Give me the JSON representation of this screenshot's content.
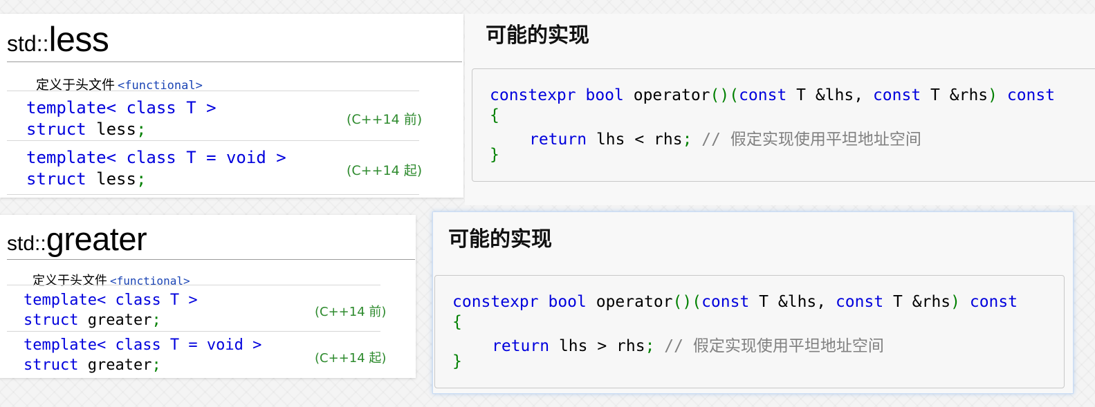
{
  "less": {
    "title_ns": "std::",
    "title_name": "less",
    "header_label": "定义于头文件",
    "header_file": "<functional>",
    "decls": [
      {
        "line1_kw": "template",
        "line1_rest": "< class T >",
        "line2_kw": "struct",
        "line2_name": " less",
        "line2_semi": ";",
        "version": "(C++14 前)"
      },
      {
        "line1_kw": "template",
        "line1_rest": "< class T = void >",
        "line2_kw": "struct",
        "line2_name": " less",
        "line2_semi": ";",
        "version": "(C++14 起)"
      }
    ],
    "impl": {
      "title": "可能的实现",
      "sig": {
        "kw1": "constexpr",
        "kw2": "bool",
        "fn": "operator",
        "p1": "()",
        "p2": "(",
        "kw3": "const",
        "t1": " T &lhs, ",
        "kw4": "const",
        "t2": " T &rhs",
        "p3": ")",
        "kw5": "const"
      },
      "open_brace": "{",
      "body": {
        "kw": "return",
        "expr": " lhs < rhs",
        "semi": ";",
        "comment": " // 假定实现使用平坦地址空间"
      },
      "close_brace": "}"
    }
  },
  "greater": {
    "title_ns": "std::",
    "title_name": "greater",
    "header_label": "定义于头文件",
    "header_file": "<functional>",
    "decls": [
      {
        "line1_kw": "template",
        "line1_rest": "< class T >",
        "line2_kw": "struct",
        "line2_name": " greater",
        "line2_semi": ";",
        "version": "(C++14 前)"
      },
      {
        "line1_kw": "template",
        "line1_rest": "< class T = void >",
        "line2_kw": "struct",
        "line2_name": " greater",
        "line2_semi": ";",
        "version": "(C++14 起)"
      }
    ],
    "impl": {
      "title": "可能的实现",
      "sig": {
        "kw1": "constexpr",
        "kw2": "bool",
        "fn": "operator",
        "p1": "()",
        "p2": "(",
        "kw3": "const",
        "t1": " T &lhs, ",
        "kw4": "const",
        "t2": " T &rhs",
        "p3": ")",
        "kw5": "const"
      },
      "open_brace": "{",
      "body": {
        "kw": "return",
        "expr": " lhs > rhs",
        "semi": ";",
        "comment": " // 假定实现使用平坦地址空间"
      },
      "close_brace": "}"
    }
  }
}
